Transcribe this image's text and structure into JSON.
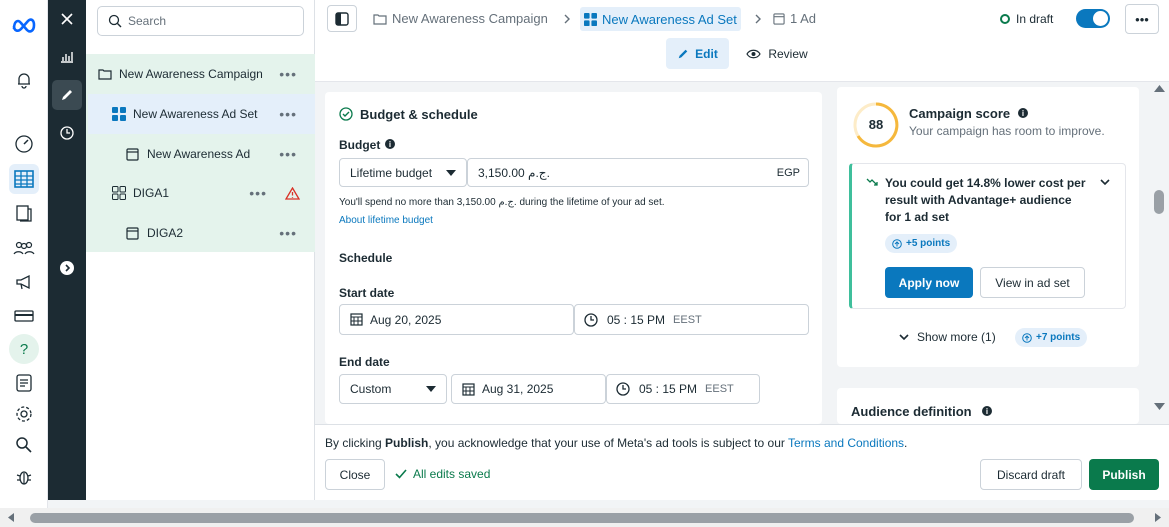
{
  "nav": {
    "logo": "meta-logo"
  },
  "tree": {
    "search_placeholder": "Search",
    "items": [
      {
        "label": "New Awareness Campaign"
      },
      {
        "label": "New Awareness Ad Set"
      },
      {
        "label": "New Awareness Ad"
      },
      {
        "label": "DIGA1"
      },
      {
        "label": "DIGA2"
      }
    ],
    "dots": "•••"
  },
  "breadcrumb": {
    "campaign": "New Awareness Campaign",
    "adset": "New Awareness Ad Set",
    "ad": "1 Ad",
    "status": "In draft",
    "more": "•••"
  },
  "tabs": {
    "edit": "Edit",
    "review": "Review"
  },
  "budget": {
    "section_title": "Budget & schedule",
    "budget_label": "Budget",
    "budget_type": "Lifetime budget",
    "amount": "3,150.00 ج.م.",
    "currency": "EGP",
    "note": "You'll spend no more than 3,150.00 ج.م. during the lifetime of your ad set.",
    "about_link": "About lifetime budget",
    "schedule_label": "Schedule",
    "start_label": "Start date",
    "start_date": "Aug 20, 2025",
    "start_time": "05 : 15 PM",
    "tz": "EEST",
    "end_label": "End date",
    "end_type": "Custom",
    "end_date": "Aug 31, 2025",
    "end_time": "05 : 15 PM"
  },
  "score": {
    "value": "88",
    "title": "Campaign score",
    "subtitle": "Your campaign has room to improve.",
    "reco": "You could get 14.8% lower cost per result with Advantage+ audience for 1 ad set",
    "points": "+5 points",
    "apply": "Apply now",
    "view": "View in ad set",
    "show_more": "Show more (1)",
    "more_points": "+7 points",
    "accent": "#f5b83d"
  },
  "audience": {
    "title": "Audience definition"
  },
  "footer": {
    "notice_pre": "By clicking ",
    "notice_bold": "Publish",
    "notice_mid": ", you acknowledge that your use of Meta's ad tools is subject to our ",
    "terms": "Terms and Conditions",
    "notice_end": ".",
    "close": "Close",
    "saved": "All edits saved",
    "discard": "Discard draft",
    "publish": "Publish"
  },
  "colors": {
    "primary": "#0a78be",
    "publish": "#0a7a4c",
    "selected_tree": "#e4f3ec",
    "selected_adset": "#e4effa"
  }
}
